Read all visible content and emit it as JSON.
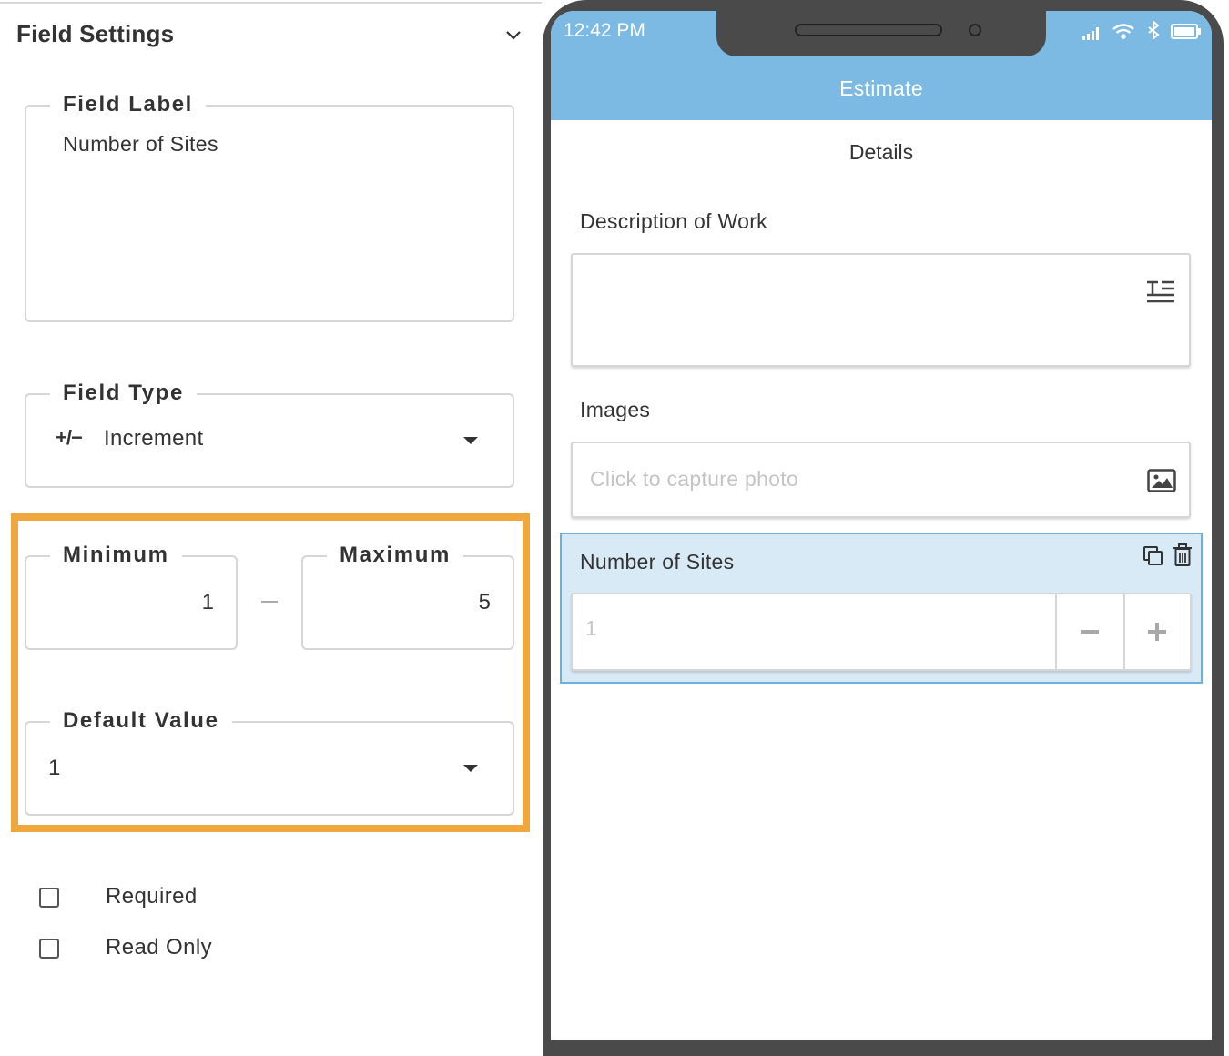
{
  "panel": {
    "title": "Field Settings",
    "field_label": {
      "legend": "Field Label",
      "value": "Number of Sites"
    },
    "field_type": {
      "legend": "Field Type",
      "icon": "+/−",
      "value": "Increment"
    },
    "minimum": {
      "legend": "Minimum",
      "value": "1"
    },
    "maximum": {
      "legend": "Maximum",
      "value": "5"
    },
    "default_value": {
      "legend": "Default Value",
      "value": "1"
    },
    "required_label": "Required",
    "readonly_label": "Read Only",
    "highlight_color": "#f0a73d"
  },
  "phone": {
    "time": "12:42 PM",
    "app_title": "Estimate",
    "section_title": "Details",
    "description_label": "Description of Work",
    "images_label": "Images",
    "photo_placeholder": "Click to capture photo",
    "selected_field_label": "Number of Sites",
    "increment_value": "1",
    "header_color": "#7cb9e3"
  }
}
